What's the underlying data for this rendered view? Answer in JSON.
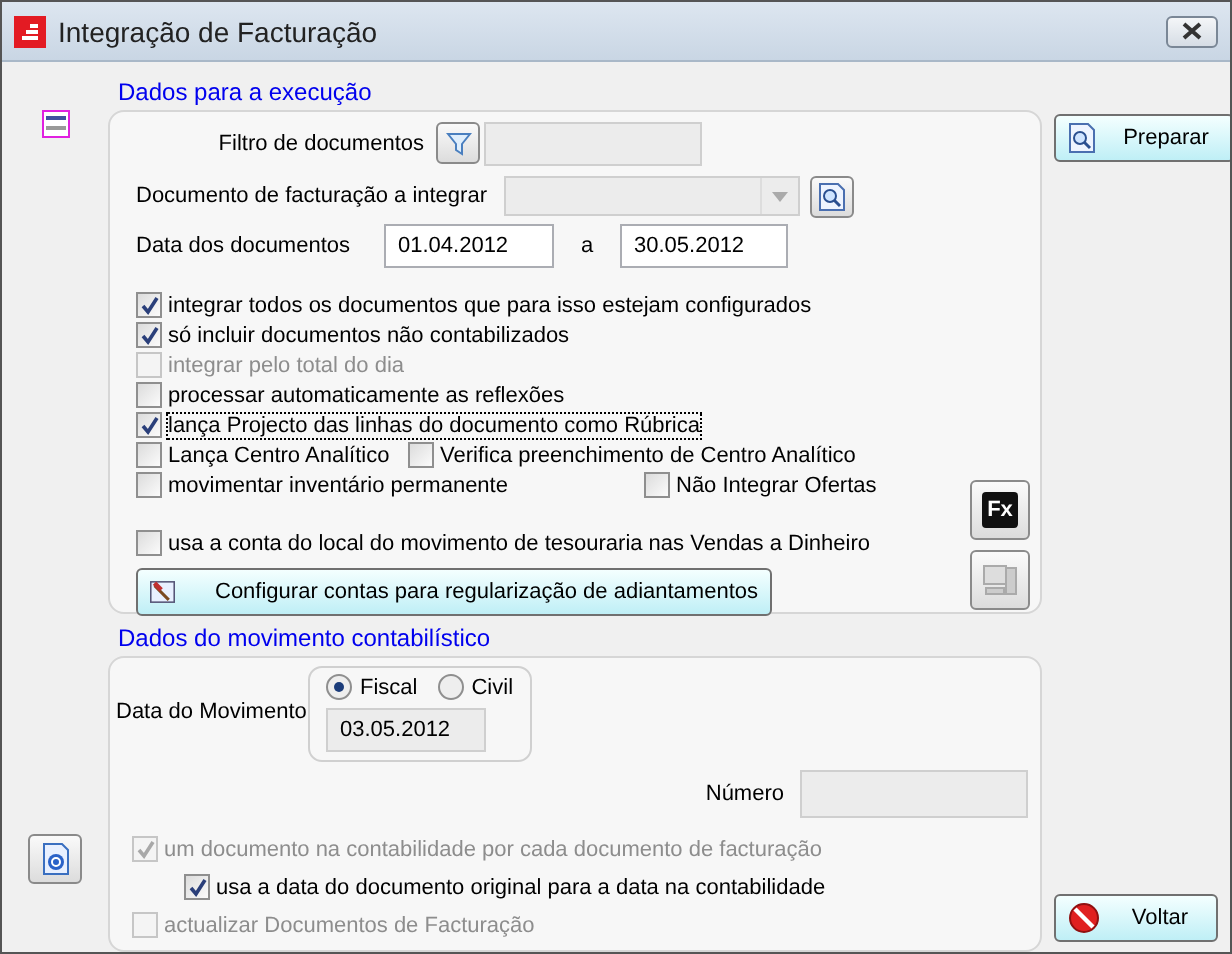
{
  "window": {
    "title": "Integração de Facturação"
  },
  "execution": {
    "title": "Dados para a execução",
    "filter": {
      "label": "Filtro de documentos"
    },
    "document": {
      "label": "Documento de facturação a integrar"
    },
    "dates": {
      "label": "Data dos documentos",
      "from": "01.04.2012",
      "separator": "a",
      "to": "30.05.2012"
    },
    "option_rows": [
      [
        {
          "label": "integrar todos os documentos que para isso estejam configurados",
          "checked": true,
          "disabled": false,
          "focused": false
        }
      ],
      [
        {
          "label": "só incluir documentos não contabilizados",
          "checked": true,
          "disabled": false,
          "focused": false
        }
      ],
      [
        {
          "label": "integrar pelo total do dia",
          "checked": false,
          "disabled": true,
          "focused": false
        }
      ],
      [
        {
          "label": "processar automaticamente as reflexões",
          "checked": false,
          "disabled": false,
          "focused": false
        }
      ],
      [
        {
          "label": "lança Projecto das linhas do documento como Rúbrica",
          "checked": true,
          "disabled": false,
          "focused": true
        }
      ],
      [
        {
          "label": "Lança Centro Analítico",
          "checked": false,
          "disabled": false,
          "focused": false
        },
        {
          "label": "Verifica preenchimento de Centro Analítico",
          "checked": false,
          "disabled": false,
          "focused": false
        }
      ],
      [
        {
          "label": "movimentar inventário permanente",
          "checked": false,
          "disabled": false,
          "focused": false
        },
        {
          "label": "Não Integrar Ofertas",
          "checked": false,
          "disabled": false,
          "focused": false
        }
      ]
    ],
    "cash_option": {
      "label": "usa a conta do local do movimento de tesouraria nas Vendas a Dinheiro",
      "checked": false,
      "disabled": false,
      "focused": false
    },
    "configure_button": "Configurar contas para regularização de adiantamentos",
    "fx_button": "Fx"
  },
  "movement": {
    "title": "Dados do movimento contabilístico",
    "date_label": "Data do Movimento",
    "radios": [
      {
        "label": "Fiscal",
        "selected": true
      },
      {
        "label": "Civil",
        "selected": false
      }
    ],
    "date": "03.05.2012",
    "number_label": "Número",
    "options": [
      {
        "label": "um documento na contabilidade por cada documento de facturação",
        "checked": true,
        "disabled": true,
        "focused": false,
        "children": [
          {
            "label": "usa a data do documento original para a data na contabilidade",
            "checked": true,
            "disabled": false,
            "focused": false
          }
        ]
      },
      {
        "label": "actualizar Documentos de Facturação",
        "checked": false,
        "disabled": true,
        "focused": false
      }
    ]
  },
  "buttons": {
    "prepare": "Preparar",
    "back": "Voltar"
  }
}
